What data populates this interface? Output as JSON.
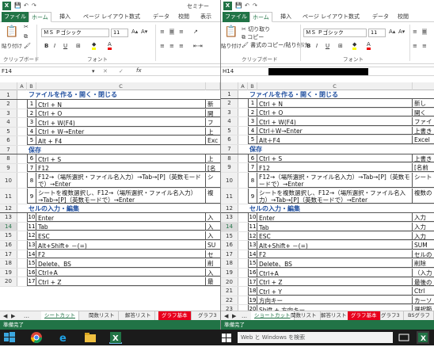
{
  "win1": {
    "title": "セミナー",
    "tabs": [
      "ファイル",
      "ホーム",
      "挿入",
      "ページ レイアウト",
      "数式",
      "データ",
      "校閲",
      "表示"
    ],
    "ribbon": {
      "clipboard_label": "クリップボード",
      "paste_label": "貼り付け",
      "font_name": "ＭＳ Ｐゴシック",
      "font_size": "11",
      "font_label": "フォント",
      "bold": "B",
      "italic": "I",
      "underline": "U"
    },
    "name_box": "F14",
    "fx": "fx",
    "columns": [
      "A",
      "B",
      "C"
    ],
    "rows": [
      {
        "n": "1",
        "type": "section",
        "text": "ファイルを作る・開く・閉じる"
      },
      {
        "n": "2",
        "b": "1",
        "c": "Ctrl + N",
        "d": "新"
      },
      {
        "n": "3",
        "b": "2",
        "c": "Ctrl + O",
        "d": "開"
      },
      {
        "n": "4",
        "b": "3",
        "c": "Ctrl + W(F4)",
        "d": "フ"
      },
      {
        "n": "5",
        "b": "4",
        "c": "Ctrl + W→Enter",
        "d": "上"
      },
      {
        "n": "6",
        "b": "5",
        "c": "Alt + F4",
        "d": "Exc"
      },
      {
        "n": "7",
        "type": "section",
        "text": "保存"
      },
      {
        "n": "8",
        "b": "6",
        "c": "Ctrl + S",
        "d": "上"
      },
      {
        "n": "9",
        "b": "7",
        "c": "F12",
        "d": "[名"
      },
      {
        "n": "10",
        "b": "8",
        "c": "F12→（場所選択・ファイル名入力）→Tab→[P]（英数モードで）→Enter",
        "d": "シ"
      },
      {
        "n": "11",
        "b": "9",
        "c": "シートを複数選択し、F12→（場所選択・ファイル名入力）→Tab→[P]（英数モードで）→Enter",
        "d": "複"
      },
      {
        "n": "12",
        "type": "section",
        "text": "セルの入力・編集"
      },
      {
        "n": "13",
        "b": "10",
        "c": "Enter",
        "d": "入"
      },
      {
        "n": "14",
        "b": "11",
        "c": "Tab",
        "d": "入"
      },
      {
        "n": "15",
        "b": "12",
        "c": "ESC",
        "d": "入"
      },
      {
        "n": "16",
        "b": "13",
        "c": "Alt+Shift+ －(=)",
        "d": "SU"
      },
      {
        "n": "17",
        "b": "14",
        "c": "F2",
        "d": "セ"
      },
      {
        "n": "18",
        "b": "15",
        "c": "Delete、BS",
        "d": "削"
      },
      {
        "n": "19",
        "b": "16",
        "c": "Ctrl+A",
        "d": "入"
      },
      {
        "n": "20",
        "b": "17",
        "c": "Ctrl + Z",
        "d": "最"
      }
    ],
    "sheet_tabs": [
      "シートカット",
      "関数リスト",
      "解答リスト",
      "グラフ基本",
      "グラフ3"
    ],
    "status": "準備完了"
  },
  "win2": {
    "tabs": [
      "ファイル",
      "ホーム",
      "挿入",
      "ページ レイアウト",
      "数式",
      "データ",
      "校閲"
    ],
    "ribbon": {
      "cut": "切り取り",
      "copy": "コピー",
      "format_painter": "書式のコピー/貼り付け",
      "paste_label": "貼り付け",
      "clipboard_label": "クリップボード",
      "font_name": "ＭＳ Ｐゴシック",
      "font_size": "11",
      "font_label": "フォント",
      "bold": "B",
      "italic": "I",
      "underline": "U"
    },
    "name_box": "H14",
    "columns": [
      "A",
      "B",
      "C"
    ],
    "rows": [
      {
        "n": "1",
        "type": "section",
        "text": "ファイルを作る・開く・閉じる"
      },
      {
        "n": "2",
        "b": "1",
        "c": "Ctrl + N",
        "d": "新し"
      },
      {
        "n": "3",
        "b": "2",
        "c": "Ctrl + O",
        "d": "開く"
      },
      {
        "n": "4",
        "b": "3",
        "c": "Ctrl + W(F4)",
        "d": "ファイ"
      },
      {
        "n": "5",
        "b": "4",
        "c": "Ctrl＋W→Enter",
        "d": "上書き"
      },
      {
        "n": "6",
        "b": "5",
        "c": "Alt＋F4",
        "d": "Excel"
      },
      {
        "n": "7",
        "type": "section",
        "text": "保存"
      },
      {
        "n": "8",
        "b": "6",
        "c": "Ctrl + S",
        "d": "上書き"
      },
      {
        "n": "9",
        "b": "7",
        "c": "F12",
        "d": "[名前"
      },
      {
        "n": "10",
        "b": "8",
        "c": "F12→（場所選択・ファイル名入力）→Tab→[P]（英数モードで）→Enter",
        "d": "シート"
      },
      {
        "n": "11",
        "b": "9",
        "c": "シートを複数選択し、F12→（場所選択・ファイル名入力）→Tab→[P]（英数モードで）→Enter",
        "d": "複数の"
      },
      {
        "n": "12",
        "type": "section",
        "text": "セルの入力・編集"
      },
      {
        "n": "13",
        "b": "10",
        "c": "Enter",
        "d": "入力"
      },
      {
        "n": "14",
        "b": "11",
        "c": "Tab",
        "d": "入力"
      },
      {
        "n": "15",
        "b": "12",
        "c": "ESC",
        "d": "入力"
      },
      {
        "n": "16",
        "b": "13",
        "c": "Alt+Shift+ －(=)",
        "d": "SUM"
      },
      {
        "n": "17",
        "b": "14",
        "c": "F2",
        "d": "セルの"
      },
      {
        "n": "18",
        "b": "15",
        "c": "Delete、BS",
        "d": "削除"
      },
      {
        "n": "19",
        "b": "16",
        "c": "Ctrl+A",
        "d": "（入力"
      },
      {
        "n": "20",
        "b": "17",
        "c": "Ctrl + Z",
        "d": "最後の"
      },
      {
        "n": "21",
        "b": "18",
        "c": "Ctrl + Y",
        "d": "Ctrl"
      },
      {
        "n": "22",
        "b": "19",
        "c": "方向キー",
        "d": "カーソ"
      },
      {
        "n": "23",
        "b": "20",
        "c": "Shift + 方向キー",
        "d": "選択範"
      }
    ],
    "sheet_tabs": [
      "ショートカット",
      "関数リスト",
      "解答リスト",
      "グラフ基本",
      "グラフ3",
      "BSグラフ"
    ],
    "status": "準備完了"
  },
  "taskbar": {
    "search_placeholder": "Web と Windows を検索"
  }
}
